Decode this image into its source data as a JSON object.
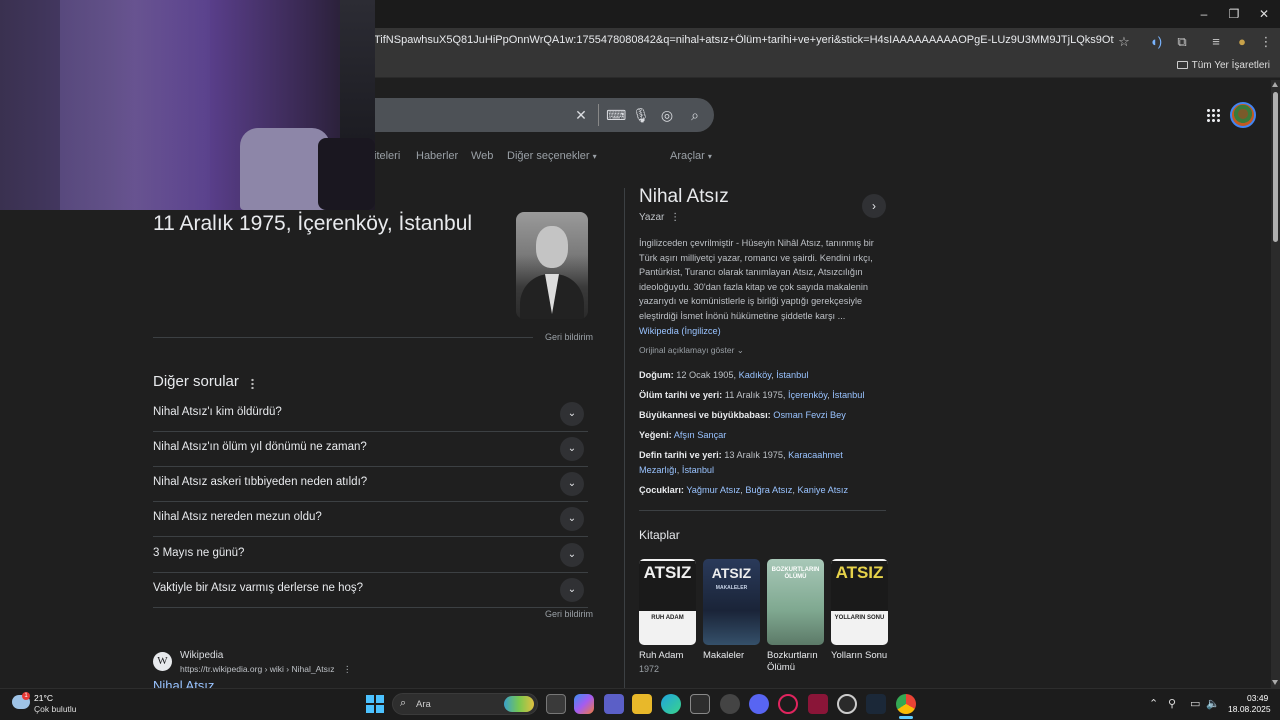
{
  "browser": {
    "url": "TifNSpawhsuX5Q81JuHiPpOnnWrQA1w:1755478080842&q=nihal+atsız+Ölüm+tarihi+ve+yeri&stick=H4sIAAAAAAAAAOPgE-LUz9U3MM9JTjLQks9OttlvSM0vyEnVT0INTk0sTk2J...",
    "bookmarks_all": "Tüm Yer İşaretleri"
  },
  "tabs": [
    "iteleri",
    "Haberler",
    "Web",
    "Diğer seçenekler",
    "Araçlar"
  ],
  "answer": {
    "text": "11 Aralık 1975, İçerenköy, İstanbul",
    "feedback": "Geri bildirim"
  },
  "other_questions": {
    "title": "Diğer sorular",
    "items": [
      "Nihal Atsız'ı kim öldürdü?",
      "Nihal Atsız'ın ölüm yıl dönümü ne zaman?",
      "Nihal Atsız askeri tıbbiyeden neden atıldı?",
      "Nihal Atsız nereden mezun oldu?",
      "3 Mayıs ne günü?",
      "Vaktiyle bir Atsız varmış derlerse ne hoş?"
    ],
    "feedback": "Geri bildirim"
  },
  "result": {
    "site": "Wikipedia",
    "url": "https://tr.wikipedia.org › wiki › Nihal_Atsız",
    "title": "Nihal Atsız",
    "favicon": "W"
  },
  "knowledge_panel": {
    "title": "Nihal Atsız",
    "subtitle": "Yazar",
    "description": "İngilizceden çevrilmiştir - Hüseyin Nihâl Atsız, tanınmış bir Türk aşırı milliyetçi yazar, romancı ve şairdi. Kendini ırkçı, Pantürkist, Turancı olarak tanımlayan Atsız, Atsızcılığın ideoloğuydu. 30'dan fazla kitap ve çok sayıda makalenin yazarıydı ve komünistlerle iş birliği yaptığı gerekçesiyle eleştirdiği İsmet İnönü hükümetine şiddetle karşı ...",
    "source_link": "Wikipedia (İngilizce)",
    "show_original": "Orijinal açıklamayı göster",
    "facts": {
      "birth_label": "Doğum:",
      "birth_text": "12 Ocak 1905,",
      "birth_link1": "Kadıköy",
      "birth_link2": "İstanbul",
      "death_label": "Ölüm tarihi ve yeri:",
      "death_text": "11 Aralık 1975,",
      "death_link1": "İçerenköy",
      "death_link2": "İstanbul",
      "grand_label": "Büyükannesi ve büyükbabası:",
      "grand_link": "Osman Fevzi Bey",
      "nephew_label": "Yeğeni:",
      "nephew_link": "Afşın Sançar",
      "burial_label": "Defin tarihi ve yeri:",
      "burial_text": "13 Aralık 1975,",
      "burial_link1": "Karacaahmet Mezarlığı",
      "burial_link2": "İstanbul",
      "children_label": "Çocukları:",
      "child1": "Yağmur Atsız",
      "child2": "Buğra Atsız",
      "child3": "Kaniye Atsız"
    },
    "books_title": "Kitaplar",
    "books": [
      {
        "title": "Ruh Adam",
        "year": "1972",
        "cover": "RUH ADAM",
        "cover_top": "ATSIZ"
      },
      {
        "title": "Makaleler",
        "year": "",
        "cover": "MAKALELER",
        "cover_top": "ATSIZ"
      },
      {
        "title": "Bozkurtların Ölümü",
        "year": "",
        "cover": "BOZKURTLARIN ÖLÜMÜ",
        "cover_top": ""
      },
      {
        "title": "Yolların Sonu",
        "year": "",
        "cover": "YOLLARIN SONU",
        "cover_top": "ATSIZ"
      }
    ]
  },
  "taskbar": {
    "temperature": "21°C",
    "weather": "Çok bulutlu",
    "weather_badge": "1",
    "search_placeholder": "Ara",
    "time": "03:49",
    "date": "18.08.2025"
  },
  "colors": {
    "background": "#1f1f1f",
    "link": "#99c3ff",
    "accent": "#60cdff"
  }
}
